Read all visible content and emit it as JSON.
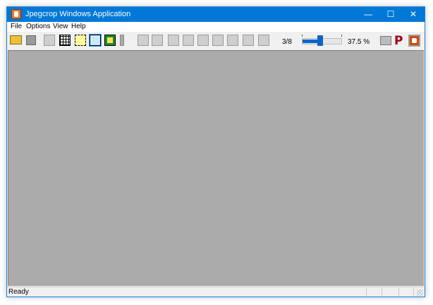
{
  "window": {
    "title": "Jpegcrop Windows Application",
    "accent_color": "#0078d7",
    "controls": {
      "minimize": "—",
      "maximize": "☐",
      "close": "✕"
    }
  },
  "menu": {
    "items": [
      "File",
      "Options",
      "View",
      "Help"
    ]
  },
  "toolbar": {
    "page_counter": "3/8",
    "zoom_level": "37.5 %",
    "zoom_slider_fraction": 0.45,
    "p_label": "P",
    "icons": [
      "open-folder-icon",
      "save-disk-icon",
      "crop-icon",
      "grid-icon",
      "selection-icon",
      "fit-window-icon",
      "fit-image-icon",
      "separator-bar",
      "copy-icon",
      "paste-icon",
      "flip-horizontal-icon",
      "flip-vertical-icon",
      "rotate-icon",
      "diagonal-icon",
      "anti-diagonal-icon",
      "trim-icon",
      "crop-center-icon",
      "print-icon",
      "p-icon",
      "about-icon"
    ]
  },
  "canvas": {
    "background": "#ababab"
  },
  "status": {
    "text": "Ready"
  }
}
